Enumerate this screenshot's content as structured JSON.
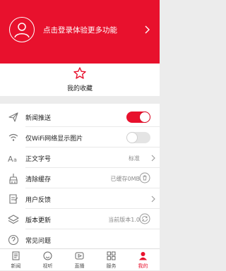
{
  "header": {
    "login_text": "点击登录体验更多功能",
    "background_color": "#e8112d"
  },
  "favorites": {
    "label": "我的收藏",
    "icon": "star-icon"
  },
  "settings": [
    {
      "label": "新闻推送",
      "icon": "send-icon",
      "control": "toggle",
      "on": true
    },
    {
      "label": "仅WiFi网络显示图片",
      "icon": "wifi-icon",
      "control": "toggle",
      "on": false
    },
    {
      "label": "正文字号",
      "icon": "font-size-icon",
      "value": "标准",
      "control": "chevron"
    },
    {
      "label": "清除缓存",
      "icon": "clean-icon",
      "value": "已缓存0MB",
      "control": "trash"
    },
    {
      "label": "用户反馈",
      "icon": "feedback-icon",
      "control": "chevron"
    },
    {
      "label": "版本更新",
      "icon": "layers-icon",
      "value": "当前版本1.0",
      "control": "refresh"
    },
    {
      "label": "常见问题",
      "icon": "help-icon"
    }
  ],
  "tabs": [
    {
      "label": "新闻",
      "icon": "news-icon",
      "active": false
    },
    {
      "label": "视听",
      "icon": "face-icon",
      "active": false
    },
    {
      "label": "直播",
      "icon": "play-icon",
      "active": false
    },
    {
      "label": "服务",
      "icon": "grid-icon",
      "active": false
    },
    {
      "label": "我的",
      "icon": "user-icon",
      "active": true
    }
  ],
  "accent_color": "#e8112d"
}
